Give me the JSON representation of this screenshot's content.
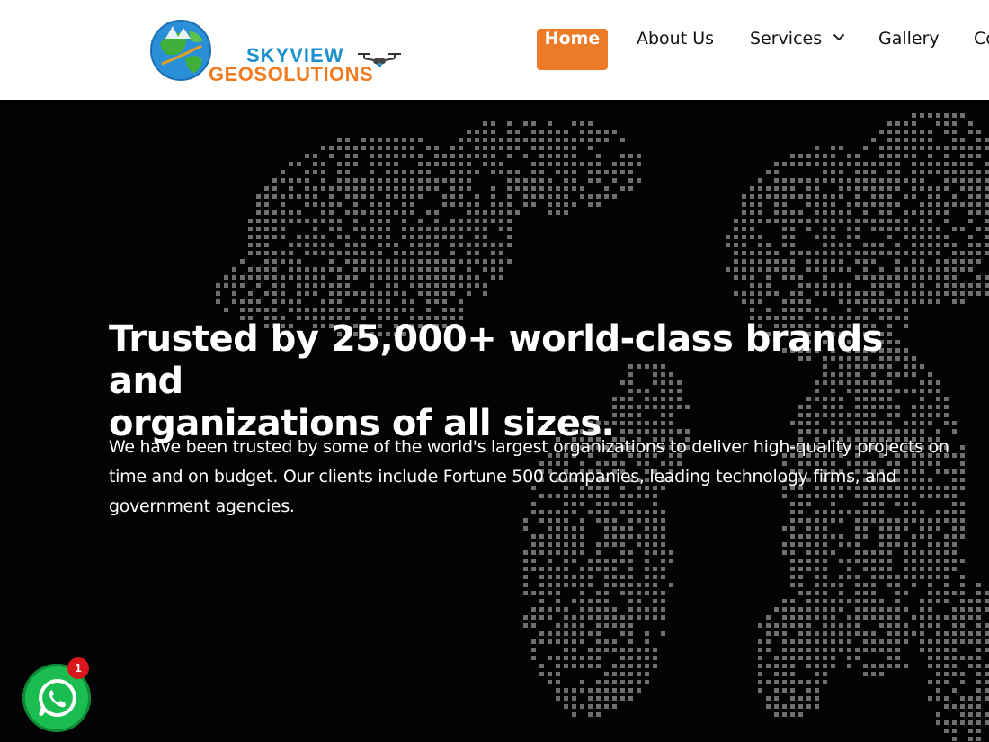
{
  "brand": {
    "name_line1": "SKYVIEW",
    "name_line2": "GEOSOLUTIONS",
    "colors": {
      "blue": "#1c8fcf",
      "orange": "#f07b20"
    },
    "icons": [
      "globe-logo-icon",
      "drone-icon"
    ]
  },
  "nav": {
    "items": [
      {
        "label": "Home",
        "active": true
      },
      {
        "label": "About Us"
      },
      {
        "label": "Services",
        "icon": "chevron-down-icon"
      },
      {
        "label": "Gallery"
      },
      {
        "label": "Co"
      }
    ],
    "active_color": "#ec7a26"
  },
  "hero": {
    "title_line1": "Trusted by 25,000+ world-class brands and",
    "title_line2": "organizations of all sizes.",
    "text_line1": "We have been trusted by some of the world's largest organizations to deliver high-quality projects on",
    "text_line2": "time and on budget. Our clients include Fortune 500 companies, leading technology firms, and",
    "text_line3": "government agencies.",
    "background": "dotted-world-map",
    "background_color": "#030204"
  },
  "whatsapp": {
    "icon": "whatsapp-icon",
    "badge_count": "1",
    "color": "#1bbd50"
  }
}
